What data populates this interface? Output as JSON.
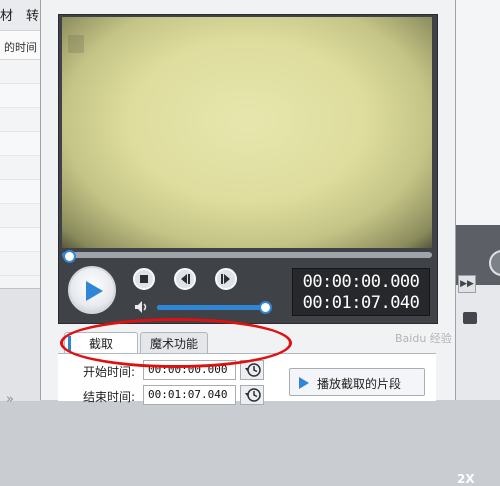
{
  "background_app": {
    "tabs": [
      "材",
      "转"
    ],
    "column_header": "的时间"
  },
  "player": {
    "current_time": "00:00:00.000",
    "total_time": "00:01:07.040",
    "progress_fraction": 0.02,
    "volume_fraction": 1.0,
    "side_badge": "2X"
  },
  "tabs": [
    {
      "label": "截取",
      "active": true
    },
    {
      "label": "魔术功能",
      "active": false
    }
  ],
  "cut_panel": {
    "start_label": "开始时间:",
    "start_value": "00:00:00.000",
    "end_label": "结束时间:",
    "end_value": "00:01:07.040",
    "play_clip_label": "播放截取的片段"
  },
  "watermark": "Baidu 经验",
  "colors": {
    "accent": "#2f86d6",
    "highlight": "#e01010"
  }
}
